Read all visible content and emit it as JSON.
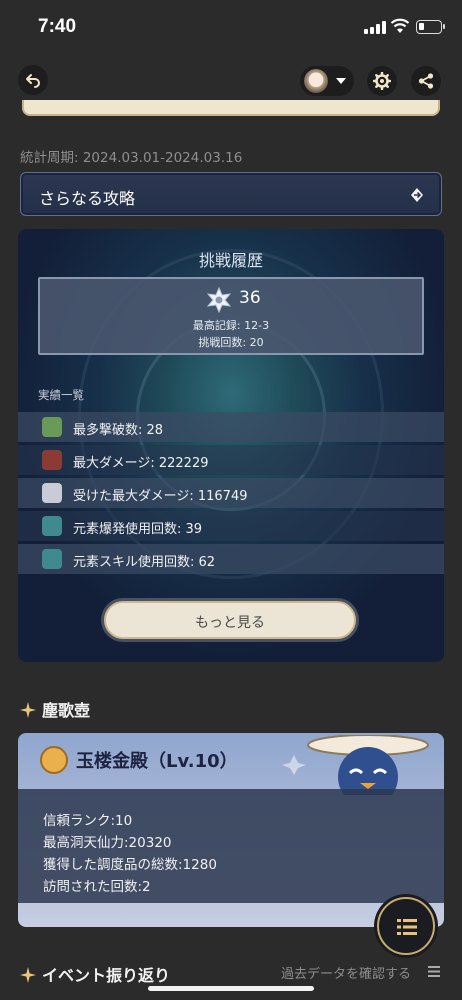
{
  "status_bar": {
    "time": "7:40"
  },
  "period": "統計周期: 2024.03.01-2024.03.16",
  "more_strategy": {
    "label": "さらなる攻略"
  },
  "challenge": {
    "title": "挑戦履歴",
    "stars": "36",
    "best_record": "最高記録: 12-3",
    "attempts": "挑戦回数: 20",
    "achievements_title": "実績一覧",
    "achievements": [
      {
        "label": "最多撃破数: 28",
        "icon_color": "#6a9a57"
      },
      {
        "label": "最大ダメージ: 222229",
        "icon_color": "#8a3b34"
      },
      {
        "label": "受けた最大ダメージ: 116749",
        "icon_color": "#c9ccd6"
      },
      {
        "label": "元素爆発使用回数: 39",
        "icon_color": "#3f8a8f"
      },
      {
        "label": "元素スキル使用回数: 62",
        "icon_color": "#3f8a8f"
      }
    ],
    "see_more": "もっと見る"
  },
  "teapot": {
    "section_title": "塵歌壺",
    "title": "玉楼金殿（Lv.10）",
    "lines": [
      "信頼ランク:10",
      "最高洞天仙力:20320",
      "獲得した調度品の総数:1280",
      "訪問された回数:2"
    ]
  },
  "events": {
    "section_title": "イベント振り返り",
    "past_link": "過去データを確認する"
  },
  "colors": {
    "accent_gold": "#c7ac6c",
    "card_blue": "#243049",
    "background": "#2b2b2b"
  },
  "icons": [
    "back-arrow-icon",
    "chevron-down-icon",
    "gear-icon",
    "share-icon",
    "diamond-arrow-icon",
    "star-icon",
    "spark-icon",
    "menu-lines-icon",
    "list-icon"
  ]
}
